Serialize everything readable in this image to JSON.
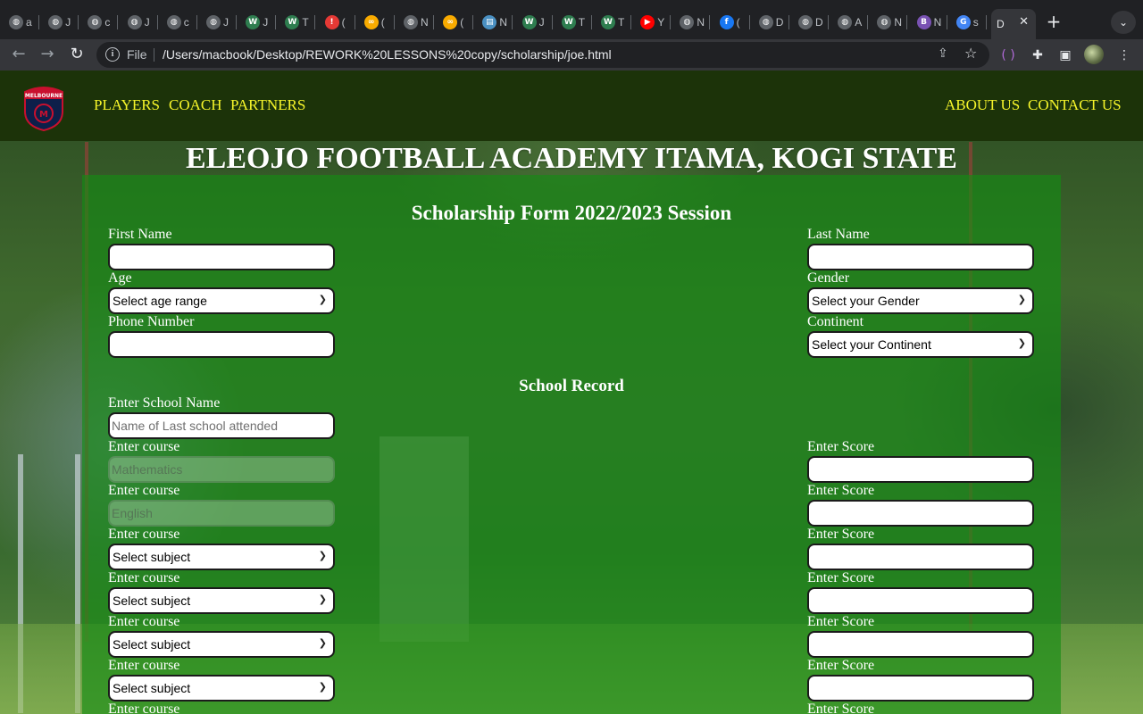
{
  "browser": {
    "tabs": [
      {
        "letter": "a",
        "icon": "globe-icon",
        "color": "#5f6368"
      },
      {
        "letter": "J",
        "icon": "globe-icon",
        "color": "#5f6368"
      },
      {
        "letter": "c",
        "icon": "globe-icon",
        "color": "#5f6368"
      },
      {
        "letter": "J",
        "icon": "globe-icon",
        "color": "#5f6368"
      },
      {
        "letter": "c",
        "icon": "globe-icon",
        "color": "#5f6368"
      },
      {
        "letter": "J",
        "icon": "globe-icon",
        "color": "#5f6368"
      },
      {
        "letter": "J",
        "icon": "webflow-icon",
        "color": "#2e7d4f"
      },
      {
        "letter": "T",
        "icon": "webflow-icon",
        "color": "#2e7d4f"
      },
      {
        "letter": "(",
        "icon": "alert-icon",
        "color": "#e53935"
      },
      {
        "letter": "(",
        "icon": "colab-icon",
        "color": "#f9ab00"
      },
      {
        "letter": "N",
        "icon": "globe-icon",
        "color": "#5f6368"
      },
      {
        "letter": "(",
        "icon": "colab-icon",
        "color": "#f9ab00"
      },
      {
        "letter": "N",
        "icon": "document-icon",
        "color": "#4a90c2"
      },
      {
        "letter": "J",
        "icon": "webflow-icon",
        "color": "#2e7d4f"
      },
      {
        "letter": "T",
        "icon": "webflow-icon",
        "color": "#2e7d4f"
      },
      {
        "letter": "T",
        "icon": "webflow-icon",
        "color": "#2e7d4f"
      },
      {
        "letter": "Y",
        "icon": "youtube-icon",
        "color": "#ff0000"
      },
      {
        "letter": "N",
        "icon": "globe-icon",
        "color": "#5f6368"
      },
      {
        "letter": "(",
        "icon": "facebook-icon",
        "color": "#1877f2"
      },
      {
        "letter": "D",
        "icon": "globe-icon",
        "color": "#5f6368"
      },
      {
        "letter": "D",
        "icon": "globe-icon",
        "color": "#5f6368"
      },
      {
        "letter": "A",
        "icon": "globe-icon",
        "color": "#5f6368"
      },
      {
        "letter": "N",
        "icon": "globe-icon",
        "color": "#5f6368"
      },
      {
        "letter": "N",
        "icon": "bootstrap-icon",
        "color": "#7952b3"
      },
      {
        "letter": "s",
        "icon": "google-icon",
        "color": "#4285f4"
      }
    ],
    "active_tab": {
      "label": "D",
      "close": "✕"
    },
    "new_tab": "+",
    "address": {
      "scheme_label": "File",
      "url": "/Users/macbook/Desktop/REWORK%20LESSONS%20copy/scholarship/joe.html"
    }
  },
  "page": {
    "logo_text": "MELBOURNE",
    "nav_left": [
      "PLAYERS",
      "COACH",
      "PARTNERS"
    ],
    "nav_right": [
      "ABOUT US",
      "CONTACT US"
    ],
    "title": "ELEOJO FOOTBALL ACADEMY ITAMA, KOGI STATE",
    "form_title": "Scholarship Form 2022/2023 Session",
    "first_name_label": "First Name",
    "last_name_label": "Last Name",
    "age_label": "Age",
    "age_select": "Select age range",
    "gender_label": "Gender",
    "gender_select": "Select your Gender",
    "phone_label": "Phone Number",
    "continent_label": "Continent",
    "continent_select": "Select your Continent",
    "school_record_title": "School Record",
    "school_name_label": "Enter School Name",
    "school_name_placeholder": "Name of Last school attended",
    "course_label": "Enter course",
    "score_label": "Enter Score",
    "course1_placeholder": "Mathematics",
    "course2_placeholder": "English",
    "subject_select": "Select subject"
  },
  "colors": {
    "navbar": "#1c3309",
    "nav_link": "#f6f52a",
    "form_panel": "rgba(20,140,20,0.62)"
  }
}
